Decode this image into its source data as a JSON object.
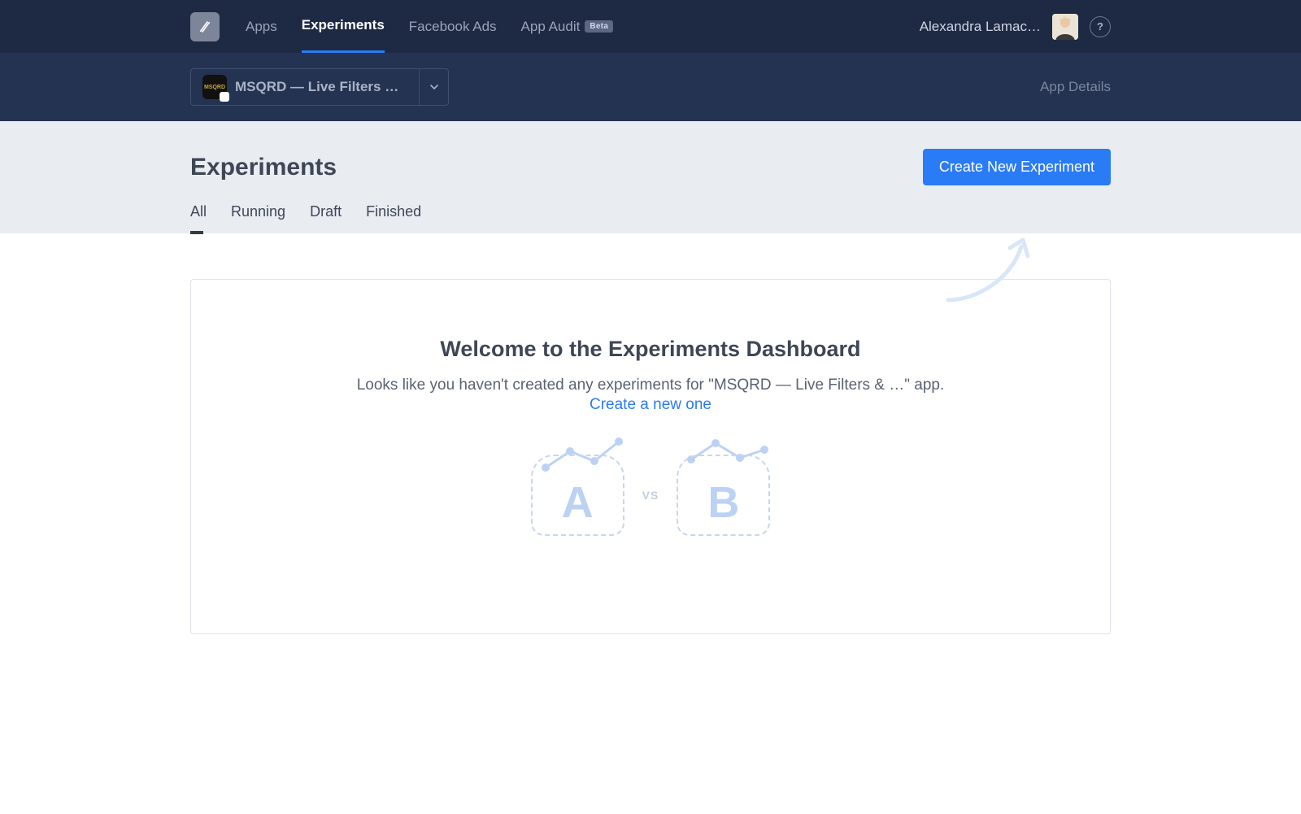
{
  "nav": {
    "items": [
      "Apps",
      "Experiments",
      "Facebook Ads",
      "App Audit"
    ],
    "beta_badge": "Beta"
  },
  "user": {
    "name": "Alexandra Lamac…"
  },
  "help": {
    "symbol": "?"
  },
  "app_selector": {
    "app_name": "MSQRD — Live Filters & F…",
    "icon_text": "MSQRD"
  },
  "subheader": {
    "details_link": "App Details"
  },
  "page": {
    "title": "Experiments",
    "new_button": "Create New Experiment",
    "tabs": [
      "All",
      "Running",
      "Draft",
      "Finished"
    ]
  },
  "empty_state": {
    "title": "Welcome to the Experiments Dashboard",
    "subtitle": "Looks like you haven't created any experiments for \"MSQRD — Live Filters & …\" app.",
    "link": "Create a new one",
    "vs": "VS",
    "letter_a": "A",
    "letter_b": "B"
  },
  "colors": {
    "accent": "#2a7bf6",
    "navy": "#1e2a44"
  }
}
